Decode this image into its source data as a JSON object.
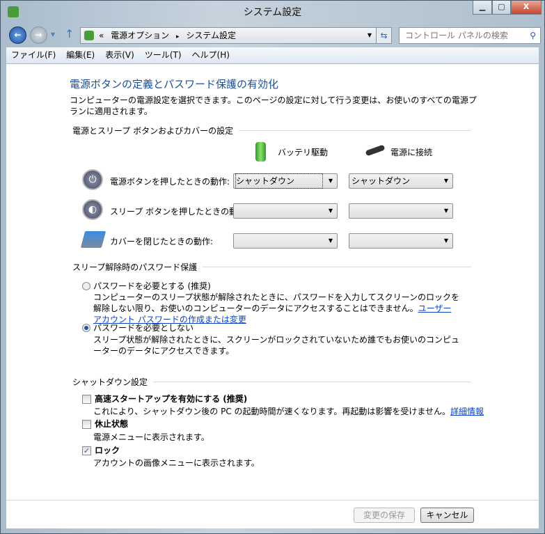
{
  "window": {
    "title": "システム設定",
    "controls": {
      "minimize": "▁",
      "maximize": "▢",
      "close": "X"
    }
  },
  "nav": {
    "breadcrumb_prefix": "«",
    "breadcrumb": [
      "電源オプション",
      "システム設定"
    ],
    "separator": "▸",
    "search_placeholder": "コントロール パネルの検索"
  },
  "menu": [
    "ファイル(F)",
    "編集(E)",
    "表示(V)",
    "ツール(T)",
    "ヘルプ(H)"
  ],
  "page": {
    "title": "電源ボタンの定義とパスワード保護の有効化",
    "description": "コンピューターの電源設定を選択できます。このページの設定に対して行う変更は、お使いのすべての電源プランに適用されます。",
    "section_buttons": "電源とスリープ ボタンおよびカバーの設定",
    "col_battery": "バッテリ駆動",
    "col_plugged": "電源に接続",
    "rows": [
      {
        "label": "電源ボタンを押したときの動作:",
        "battery": "シャットダウン",
        "plugged": "シャットダウン"
      },
      {
        "label": "スリープ ボタンを押したときの動作:",
        "battery": "",
        "plugged": ""
      },
      {
        "label": "カバーを閉じたときの動作:",
        "battery": "",
        "plugged": ""
      }
    ],
    "section_password": "スリープ解除時のパスワード保護",
    "pw_require": {
      "label": "パスワードを必要とする (推奨)",
      "desc": "コンピューターのスリープ状態が解除されたときに、パスワードを入力してスクリーンのロックを解除しない限り、お使いのコンピューターのデータにアクセスすることはできません。",
      "link": "ユーザー アカウント パスワードの作成または変更",
      "selected": false
    },
    "pw_none": {
      "label": "パスワードを必要としない",
      "desc": "スリープ状態が解除されたときに、スクリーンがロックされていないため誰でもお使いのコンピューターのデータにアクセスできます。",
      "selected": true
    },
    "section_shutdown": "シャットダウン設定",
    "fast_startup": {
      "label": "高速スタートアップを有効にする (推奨)",
      "desc": "これにより、シャットダウン後の PC の起動時間が速くなります。再起動は影響を受けません。",
      "link": "詳細情報",
      "checked": false
    },
    "hibernate": {
      "label": "休止状態",
      "desc": "電源メニューに表示されます。",
      "checked": false
    },
    "lock": {
      "label": "ロック",
      "desc": "アカウントの画像メニューに表示されます。",
      "checked": true
    },
    "save_label": "変更の保存",
    "cancel_label": "キャンセル"
  }
}
